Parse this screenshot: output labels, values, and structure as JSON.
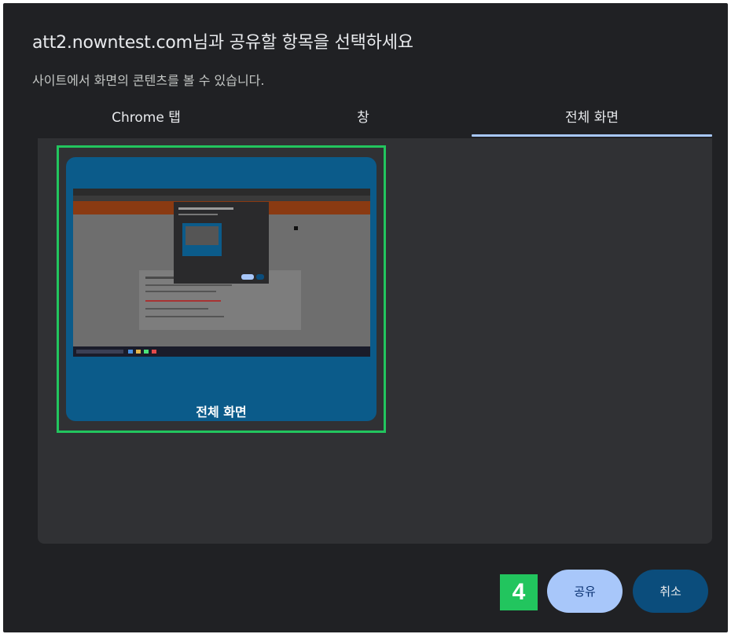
{
  "dialog": {
    "title": "att2.nowntest.com님과 공유할 항목을 선택하세요",
    "subtitle": "사이트에서 화면의 콘텐츠를 볼 수 있습니다."
  },
  "tabs": [
    {
      "label": "Chrome 탭",
      "active": false
    },
    {
      "label": "창",
      "active": false
    },
    {
      "label": "전체 화면",
      "active": true
    }
  ],
  "sources": [
    {
      "label": "전체 화면",
      "selected": true
    }
  ],
  "buttons": {
    "share_label": "공유",
    "cancel_label": "취소"
  },
  "annotation": {
    "step_number": "4"
  },
  "colors": {
    "dialog_bg": "#202124",
    "panel_bg": "#303134",
    "active_tab_underline": "#a8c7fa",
    "selection_outline": "#22c55e",
    "share_button": "#a8c7fa",
    "cancel_button": "#0b4d7c"
  }
}
